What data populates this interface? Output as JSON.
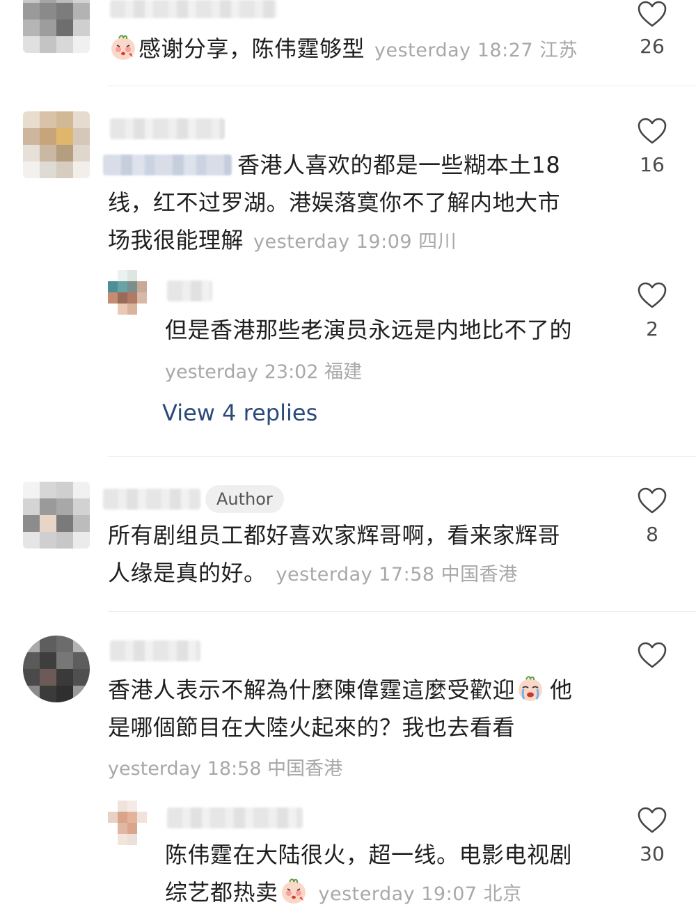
{
  "comments": [
    {
      "text": "感谢分享，陈伟霆够型",
      "meta": "yesterday 18:27 江苏",
      "likes": "26"
    },
    {
      "text_line1": "香港人喜欢的都是一些糊本土18",
      "text_line2": "线，红不过罗湖。港娱落寞你不了解内地大市",
      "text_line3": "场我很能理解",
      "meta": "yesterday 19:09 四川",
      "likes": "16",
      "reply": {
        "text": "但是香港那些老演员永远是内地比不了的",
        "meta": "yesterday 23:02 福建",
        "likes": "2"
      },
      "view_replies": "View 4 replies"
    },
    {
      "badge": "Author",
      "text_line1": "所有剧组员工都好喜欢家辉哥啊，看来家辉哥",
      "text_line2": "人缘是真的好。",
      "meta": "yesterday 17:58 中国香港",
      "likes": "8"
    },
    {
      "text_line1a": "香港人表示不解為什麼陳偉霆這麼受歡迎",
      "text_line1b": "他",
      "text_line2": "是哪個節目在大陸火起來的？我也去看看",
      "meta": "yesterday 18:58 中国香港",
      "reply": {
        "text_line1": "陈伟霆在大陆很火，超一线。电影电视剧",
        "text_line2": "综艺都热卖",
        "meta": "yesterday 19:07 北京",
        "likes": "30"
      }
    }
  ],
  "icons": {
    "heart": "heart-outline-icon",
    "emoji_blush": "blushing-face-emoji",
    "emoji_cry": "crying-face-emoji"
  },
  "colors": {
    "meta_gray": "#a8a8a8",
    "link_blue": "#2b4a7a",
    "text": "#1f1f1f"
  }
}
